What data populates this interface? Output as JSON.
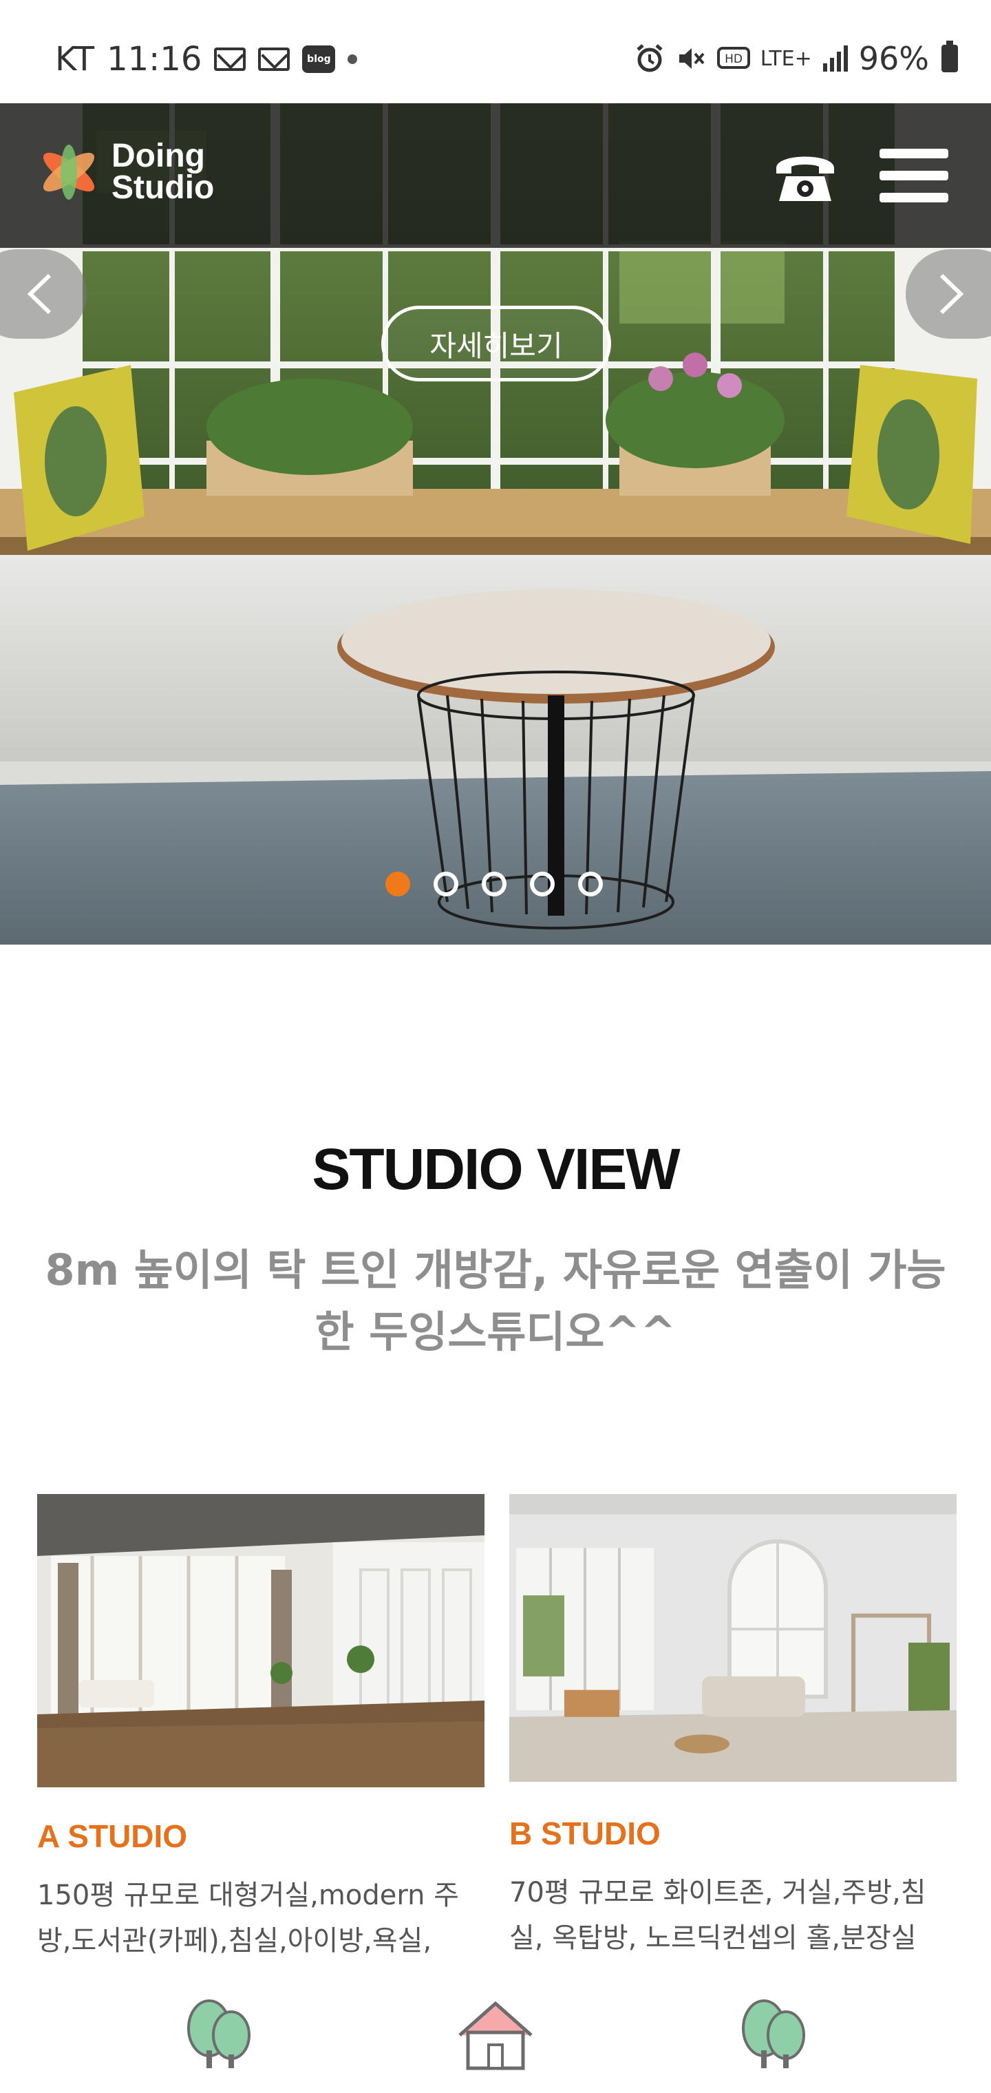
{
  "status_bar": {
    "carrier": "KT",
    "time": "11:16",
    "blog_badge": "blog",
    "network": "LTE+",
    "battery": "96%"
  },
  "header": {
    "logo_line1": "Doing",
    "logo_line2": "Studio"
  },
  "hero": {
    "detail_button": "자세히보기",
    "slides_total": 5,
    "active_slide": 1
  },
  "studio_view": {
    "title": "STUDIO VIEW",
    "subtitle": "8m 높이의 탁 트인 개방감, 자유로운 연출이 가능한 두잉스튜디오^^"
  },
  "cards": [
    {
      "title": "A STUDIO",
      "description": "150평 규모로 대형거실,modern 주방,도서관(카페),침실,아이방,욕실,"
    },
    {
      "title": "B STUDIO",
      "description": "70평 규모로 화이트존, 거실,주방,침실, 옥탑방, 노르딕컨셉의 홀,분장실"
    }
  ],
  "colors": {
    "accent": "#e5711c",
    "pager_active": "#f07a1a",
    "header_bg": "#191919",
    "subtitle": "#8e8e8e"
  },
  "icons": {
    "phone": "phone-icon",
    "menu": "hamburger-menu-icon",
    "prev": "chevron-left-icon",
    "next": "chevron-right-icon",
    "tab1": "tree-icon",
    "tab2": "house-icon",
    "tab3": "tree-icon"
  }
}
